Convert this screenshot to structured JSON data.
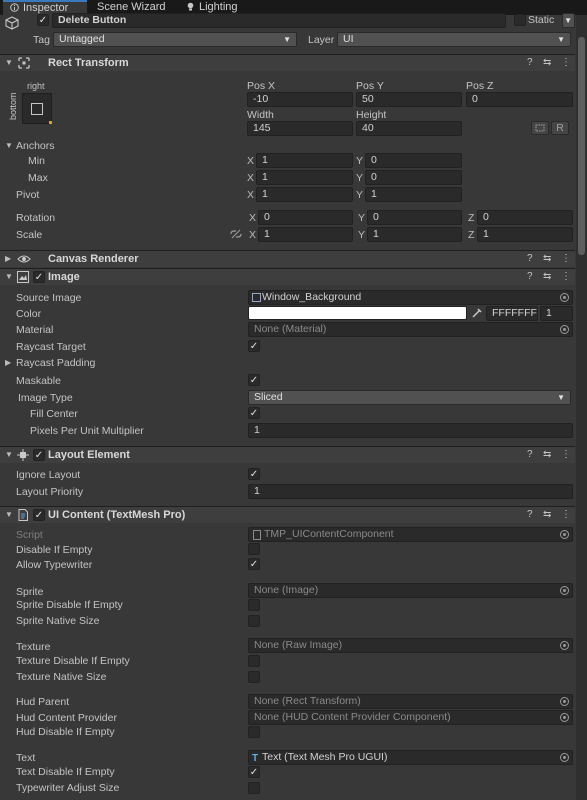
{
  "tabs": [
    {
      "label": "Inspector",
      "icon": "info-icon"
    },
    {
      "label": "Scene Wizard",
      "icon": ""
    },
    {
      "label": "Lighting",
      "icon": "bulb-icon"
    }
  ],
  "gameobject": {
    "name": "Delete Button",
    "static_label": "Static",
    "tag_label": "Tag",
    "tag_value": "Untagged",
    "layer_label": "Layer",
    "layer_value": "UI"
  },
  "rect_transform": {
    "title": "Rect Transform",
    "anchor_preset_h": "right",
    "anchor_preset_v": "bottom",
    "pos_x_label": "Pos X",
    "pos_x": "-10",
    "pos_y_label": "Pos Y",
    "pos_y": "50",
    "pos_z_label": "Pos Z",
    "pos_z": "0",
    "width_label": "Width",
    "width": "145",
    "height_label": "Height",
    "height": "40",
    "raw_edit_label": "R",
    "anchors_label": "Anchors",
    "min_label": "Min",
    "min_x": "1",
    "min_y": "0",
    "max_label": "Max",
    "max_x": "1",
    "max_y": "0",
    "pivot_label": "Pivot",
    "pivot_x": "1",
    "pivot_y": "1",
    "rotation_label": "Rotation",
    "rot_x": "0",
    "rot_y": "0",
    "rot_z": "0",
    "scale_label": "Scale",
    "scale_x": "1",
    "scale_y": "1",
    "scale_z": "1",
    "axis_x": "X",
    "axis_y": "Y",
    "axis_z": "Z"
  },
  "canvas_renderer": {
    "title": "Canvas Renderer"
  },
  "image": {
    "title": "Image",
    "source_image_label": "Source Image",
    "source_image": "Window_Background",
    "color_label": "Color",
    "color_hex": "FFFFFFFF",
    "color_alpha": "1",
    "color_swatch": "#ffffff",
    "material_label": "Material",
    "material": "None (Material)",
    "raycast_target_label": "Raycast Target",
    "raycast_target": true,
    "raycast_padding_label": "Raycast Padding",
    "maskable_label": "Maskable",
    "maskable": true,
    "image_type_label": "Image Type",
    "image_type": "Sliced",
    "fill_center_label": "Fill Center",
    "fill_center": true,
    "ppu_label": "Pixels Per Unit Multiplier",
    "ppu": "1"
  },
  "layout_element": {
    "title": "Layout Element",
    "ignore_layout_label": "Ignore Layout",
    "ignore_layout": true,
    "layout_priority_label": "Layout Priority",
    "layout_priority": "1"
  },
  "ui_content": {
    "title": "UI Content (TextMesh Pro)",
    "script_label": "Script",
    "script": "TMP_UIContentComponent",
    "disable_if_empty_label": "Disable If Empty",
    "disable_if_empty": false,
    "allow_typewriter_label": "Allow Typewriter",
    "allow_typewriter": true,
    "sprite_label": "Sprite",
    "sprite": "None (Image)",
    "sprite_disable_label": "Sprite Disable If Empty",
    "sprite_disable": false,
    "sprite_native_label": "Sprite Native Size",
    "sprite_native": false,
    "texture_label": "Texture",
    "texture": "None (Raw Image)",
    "texture_disable_label": "Texture Disable If Empty",
    "texture_disable": false,
    "texture_native_label": "Texture Native Size",
    "texture_native": false,
    "hud_parent_label": "Hud Parent",
    "hud_parent": "None (Rect Transform)",
    "hud_provider_label": "Hud Content Provider",
    "hud_provider": "None (HUD Content Provider Component)",
    "hud_disable_label": "Hud Disable If Empty",
    "hud_disable": false,
    "text_label": "Text",
    "text": "Text (Text Mesh Pro UGUI)",
    "text_disable_label": "Text Disable If Empty",
    "text_disable": true,
    "typewriter_adjust_label": "Typewriter Adjust Size",
    "typewriter_adjust": false
  },
  "header_icons": {
    "help": "?",
    "presets": "⇆",
    "menu": "⋮"
  },
  "colors": {
    "accent": "#3a79bb",
    "panel": "#383838",
    "field": "#2a2a2a",
    "header": "#3e3e3e"
  }
}
